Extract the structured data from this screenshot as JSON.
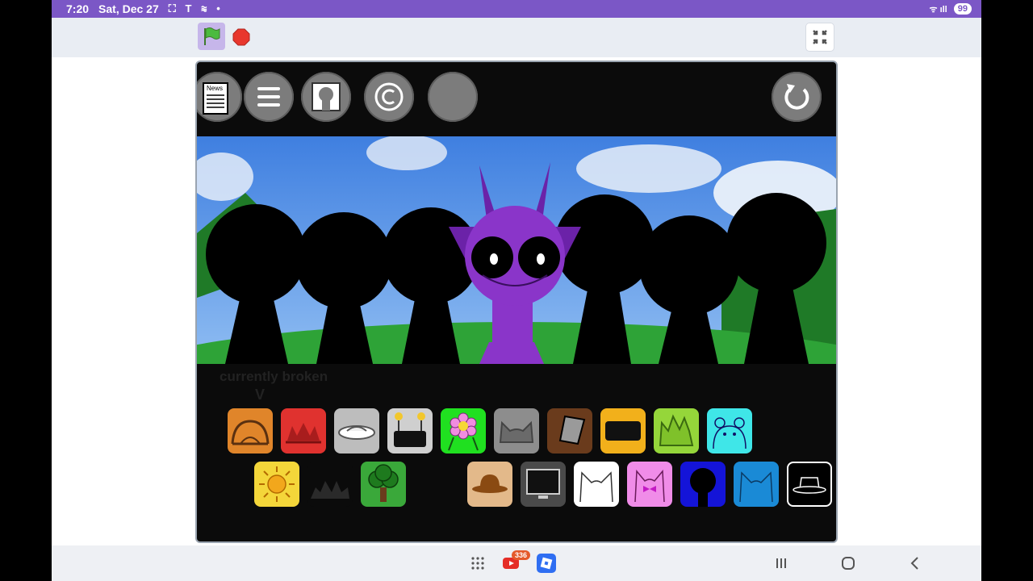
{
  "status_bar": {
    "time": "7:20",
    "date": "Sat, Dec 27",
    "left_icons": "⛶ T ≋ •",
    "signal": "ᯤ ıll",
    "battery": "99"
  },
  "toolbar": {
    "green_flag": "green-flag",
    "stop": "stop-sign",
    "fullscreen": "exit-fullscreen"
  },
  "stage": {
    "top_buttons": [
      "news",
      "menu",
      "profile",
      "copyright",
      "blank"
    ],
    "news_label": "News",
    "reset": "reset",
    "broken_label": "currently broken",
    "arrow_label": "V"
  },
  "palette": {
    "row1": [
      "orange-face",
      "red-crown",
      "gray-disc",
      "robot-screen",
      "flower",
      "gray-ears",
      "brown-bucket",
      "yellow-screen",
      "lime-spikes",
      "cyan-bear"
    ],
    "row2": [
      "sun",
      "dark-crown",
      "tree",
      "brown-hat",
      "monitor",
      "white-ears",
      "pink-bow",
      "blue-circle",
      "blue-ears",
      "black-hat"
    ]
  },
  "nav_bar": {
    "youtube_badge": "336",
    "items": [
      "apps",
      "youtube",
      "roblox",
      "recents",
      "home",
      "back"
    ]
  },
  "colors": {
    "status_bar": "#7b57c6",
    "purple_character": "#8a35c9",
    "sky": "#4a86e8",
    "grass": "#2ea337"
  }
}
